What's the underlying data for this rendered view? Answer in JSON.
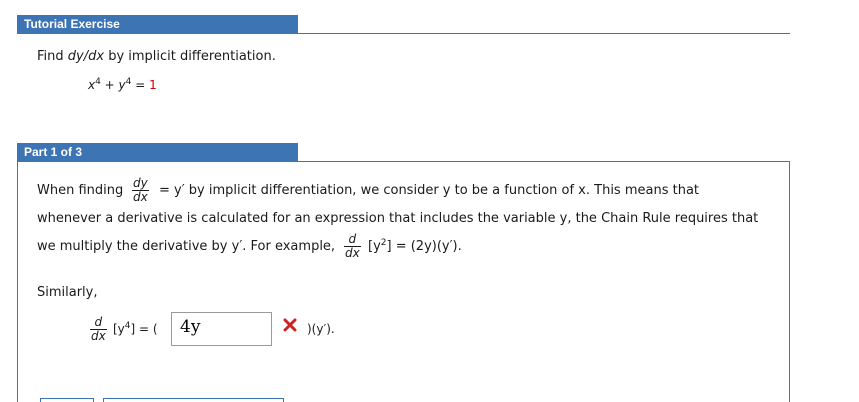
{
  "tutorial": {
    "tab_label": "Tutorial Exercise",
    "prompt_prefix": "Find ",
    "prompt_dydx": "dy/dx",
    "prompt_suffix": " by implicit differentiation.",
    "equation": {
      "x": "x",
      "exp1": "4",
      "plus": " + ",
      "y": "y",
      "exp2": "4",
      "eq": " = ",
      "rhs": "1"
    }
  },
  "part": {
    "tab_label": "Part 1 of 3",
    "line1_a": "When finding",
    "frac_dy": "dy",
    "frac_dx": "dx",
    "line1_b": "= y′  by implicit differentiation, we consider y to be a function of x. This means that",
    "line2": "whenever a derivative is calculated for an expression that includes the variable y, the Chain Rule requires that",
    "line3_a": "we multiply the derivative by y′. For example,",
    "frac_d": "d",
    "frac_dx2": "dx",
    "line3_b": "[y",
    "line3_exp": "2",
    "line3_c": "] = (2y)(y′).",
    "similarly": "Similarly,",
    "sim_frac_d": "d",
    "sim_frac_dx": "dx",
    "sim_expr_a": "[y",
    "sim_expr_exp": "4",
    "sim_expr_b": "] = (",
    "answer_value": "4y",
    "after_answer": ")(y′).",
    "status_icon": "x-mark-icon",
    "status_color": "#cc2222"
  },
  "colors": {
    "accent": "#3d74b3",
    "text": "#1a1a1a",
    "rhs": "#cc0000"
  }
}
